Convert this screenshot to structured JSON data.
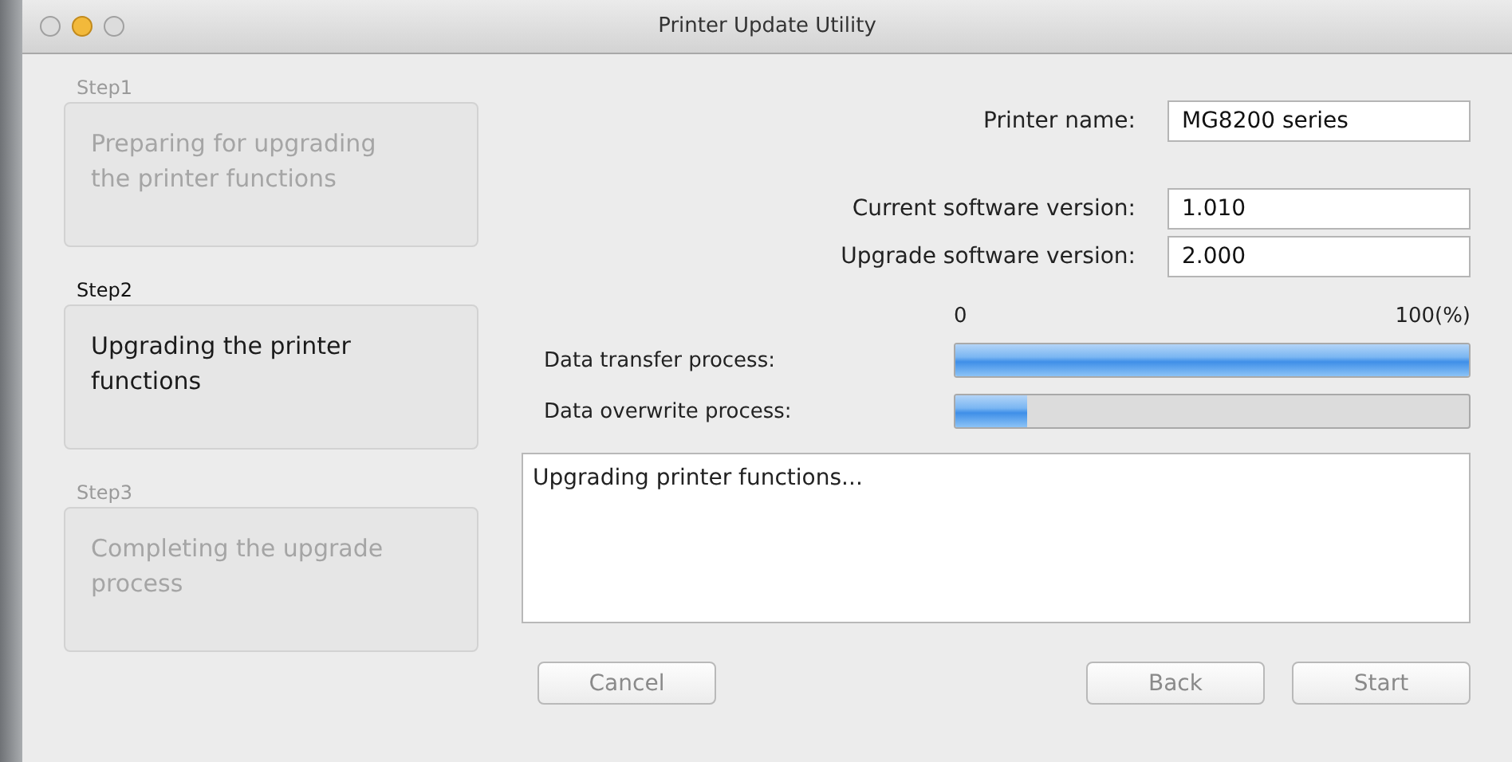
{
  "window": {
    "title": "Printer Update Utility"
  },
  "steps": [
    {
      "label": "Step1",
      "text": "Preparing for upgrading the printer functions",
      "active": false
    },
    {
      "label": "Step2",
      "text": "Upgrading the printer functions",
      "active": true
    },
    {
      "label": "Step3",
      "text": "Completing the upgrade process",
      "active": false
    }
  ],
  "fields": [
    {
      "label": "Printer name:",
      "value": "MG8200 series"
    },
    {
      "label": "Current software version:",
      "value": "1.010"
    },
    {
      "label": "Upgrade software version:",
      "value": "2.000"
    }
  ],
  "scale": {
    "min": "0",
    "max": "100(%)"
  },
  "progress": [
    {
      "label": "Data transfer process:",
      "level": 1.0
    },
    {
      "label": "Data overwrite process:",
      "level": 0.14
    }
  ],
  "log": "Upgrading printer functions...",
  "buttons": [
    {
      "label": "Cancel",
      "disabled": true
    },
    {
      "label": "Back",
      "disabled": true
    },
    {
      "label": "Start",
      "disabled": true
    }
  ]
}
